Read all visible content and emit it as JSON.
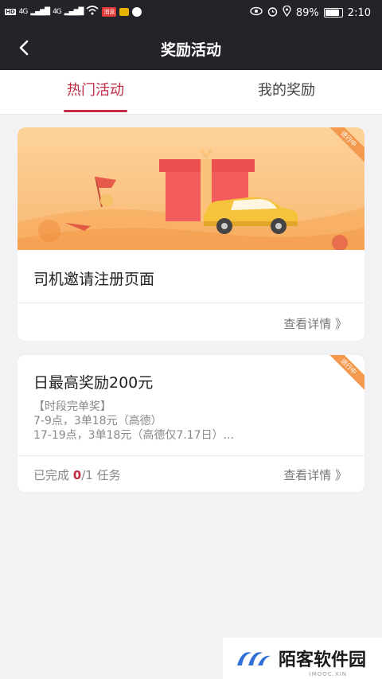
{
  "status_bar": {
    "network_type": "4G",
    "network_type_2": "4G",
    "badge_text": "消息",
    "battery": "89%",
    "time": "2:10"
  },
  "nav": {
    "title": "奖励活动"
  },
  "tabs": [
    {
      "label": "热门活动",
      "active": true
    },
    {
      "label": "我的奖励",
      "active": false
    }
  ],
  "activities": [
    {
      "ribbon": "进行中",
      "title": "司机邀请注册页面",
      "detail_link": "查看详情 》"
    },
    {
      "ribbon": "进行中",
      "title": "日最高奖励200元",
      "desc_lines": [
        "【时段完单奖】",
        "7-9点，3单18元（高德）",
        "17-19点，3单18元（高德仅7.17日）..."
      ],
      "progress_prefix": "已完成 ",
      "progress_done": "0",
      "progress_suffix": "/1 任务",
      "detail_link": "查看详情 》"
    }
  ],
  "watermark": {
    "text": "陌客软件园",
    "sub": "IMOOC.XIN"
  }
}
